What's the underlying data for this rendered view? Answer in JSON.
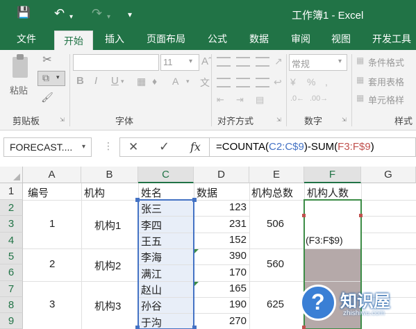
{
  "window": {
    "title": "工作簿1 - Excel",
    "icons": {
      "save": "save-icon",
      "undo": "undo-icon",
      "redo": "redo-icon"
    }
  },
  "tabs": [
    "文件",
    "开始",
    "插入",
    "页面布局",
    "公式",
    "数据",
    "审阅",
    "视图",
    "开发工具"
  ],
  "ribbon": {
    "clipboard": {
      "paste_label": "粘贴",
      "group_label": "剪贴板"
    },
    "font": {
      "size_value": "11",
      "bold": "B",
      "italic": "I",
      "underline": "U",
      "group_label": "字体"
    },
    "alignment": {
      "group_label": "对齐方式"
    },
    "number": {
      "format_value": "常规",
      "group_label": "数字"
    },
    "styles": {
      "conditional": "条件格式",
      "table": "套用表格",
      "cell": "单元格样",
      "group_label": "样式"
    }
  },
  "formula_bar": {
    "name_box": "FORECAST....",
    "fx": "fx",
    "cancel": "✕",
    "enter": "✓",
    "formula_parts": [
      "=COUNTA(",
      "C2:C$9",
      ")-SUM(",
      "F3:F$9",
      ")"
    ]
  },
  "colors": {
    "brand": "#217346",
    "ref_blue": "#4472c4",
    "ref_red": "#c0504d",
    "selected_range": "#e8eef8",
    "merged_dark": "#b5a9a9"
  },
  "grid": {
    "columns": [
      "A",
      "B",
      "C",
      "D",
      "E",
      "F",
      "G"
    ],
    "rows": [
      "1",
      "2",
      "3",
      "4",
      "5",
      "6",
      "7",
      "8",
      "9"
    ],
    "headers": {
      "A": "编号",
      "B": "机构",
      "C": "姓名",
      "D": "数据",
      "E": "机构总数",
      "F": "机构人数"
    },
    "names": [
      "张三",
      "李四",
      "王五",
      "李海",
      "满江",
      "赵山",
      "孙谷",
      "于沟"
    ],
    "values": [
      "123",
      "231",
      "152",
      "390",
      "170",
      "165",
      "190",
      "270"
    ],
    "groups": [
      {
        "no": "1",
        "org": "机构1",
        "total": "506"
      },
      {
        "no": "2",
        "org": "机构2",
        "total": "560"
      },
      {
        "no": "3",
        "org": "机构3",
        "total": "625"
      }
    ],
    "f_edit_text": "(F3:F$9)"
  },
  "watermark": {
    "text": "知识屋",
    "sub": "zhishiwu.com"
  }
}
